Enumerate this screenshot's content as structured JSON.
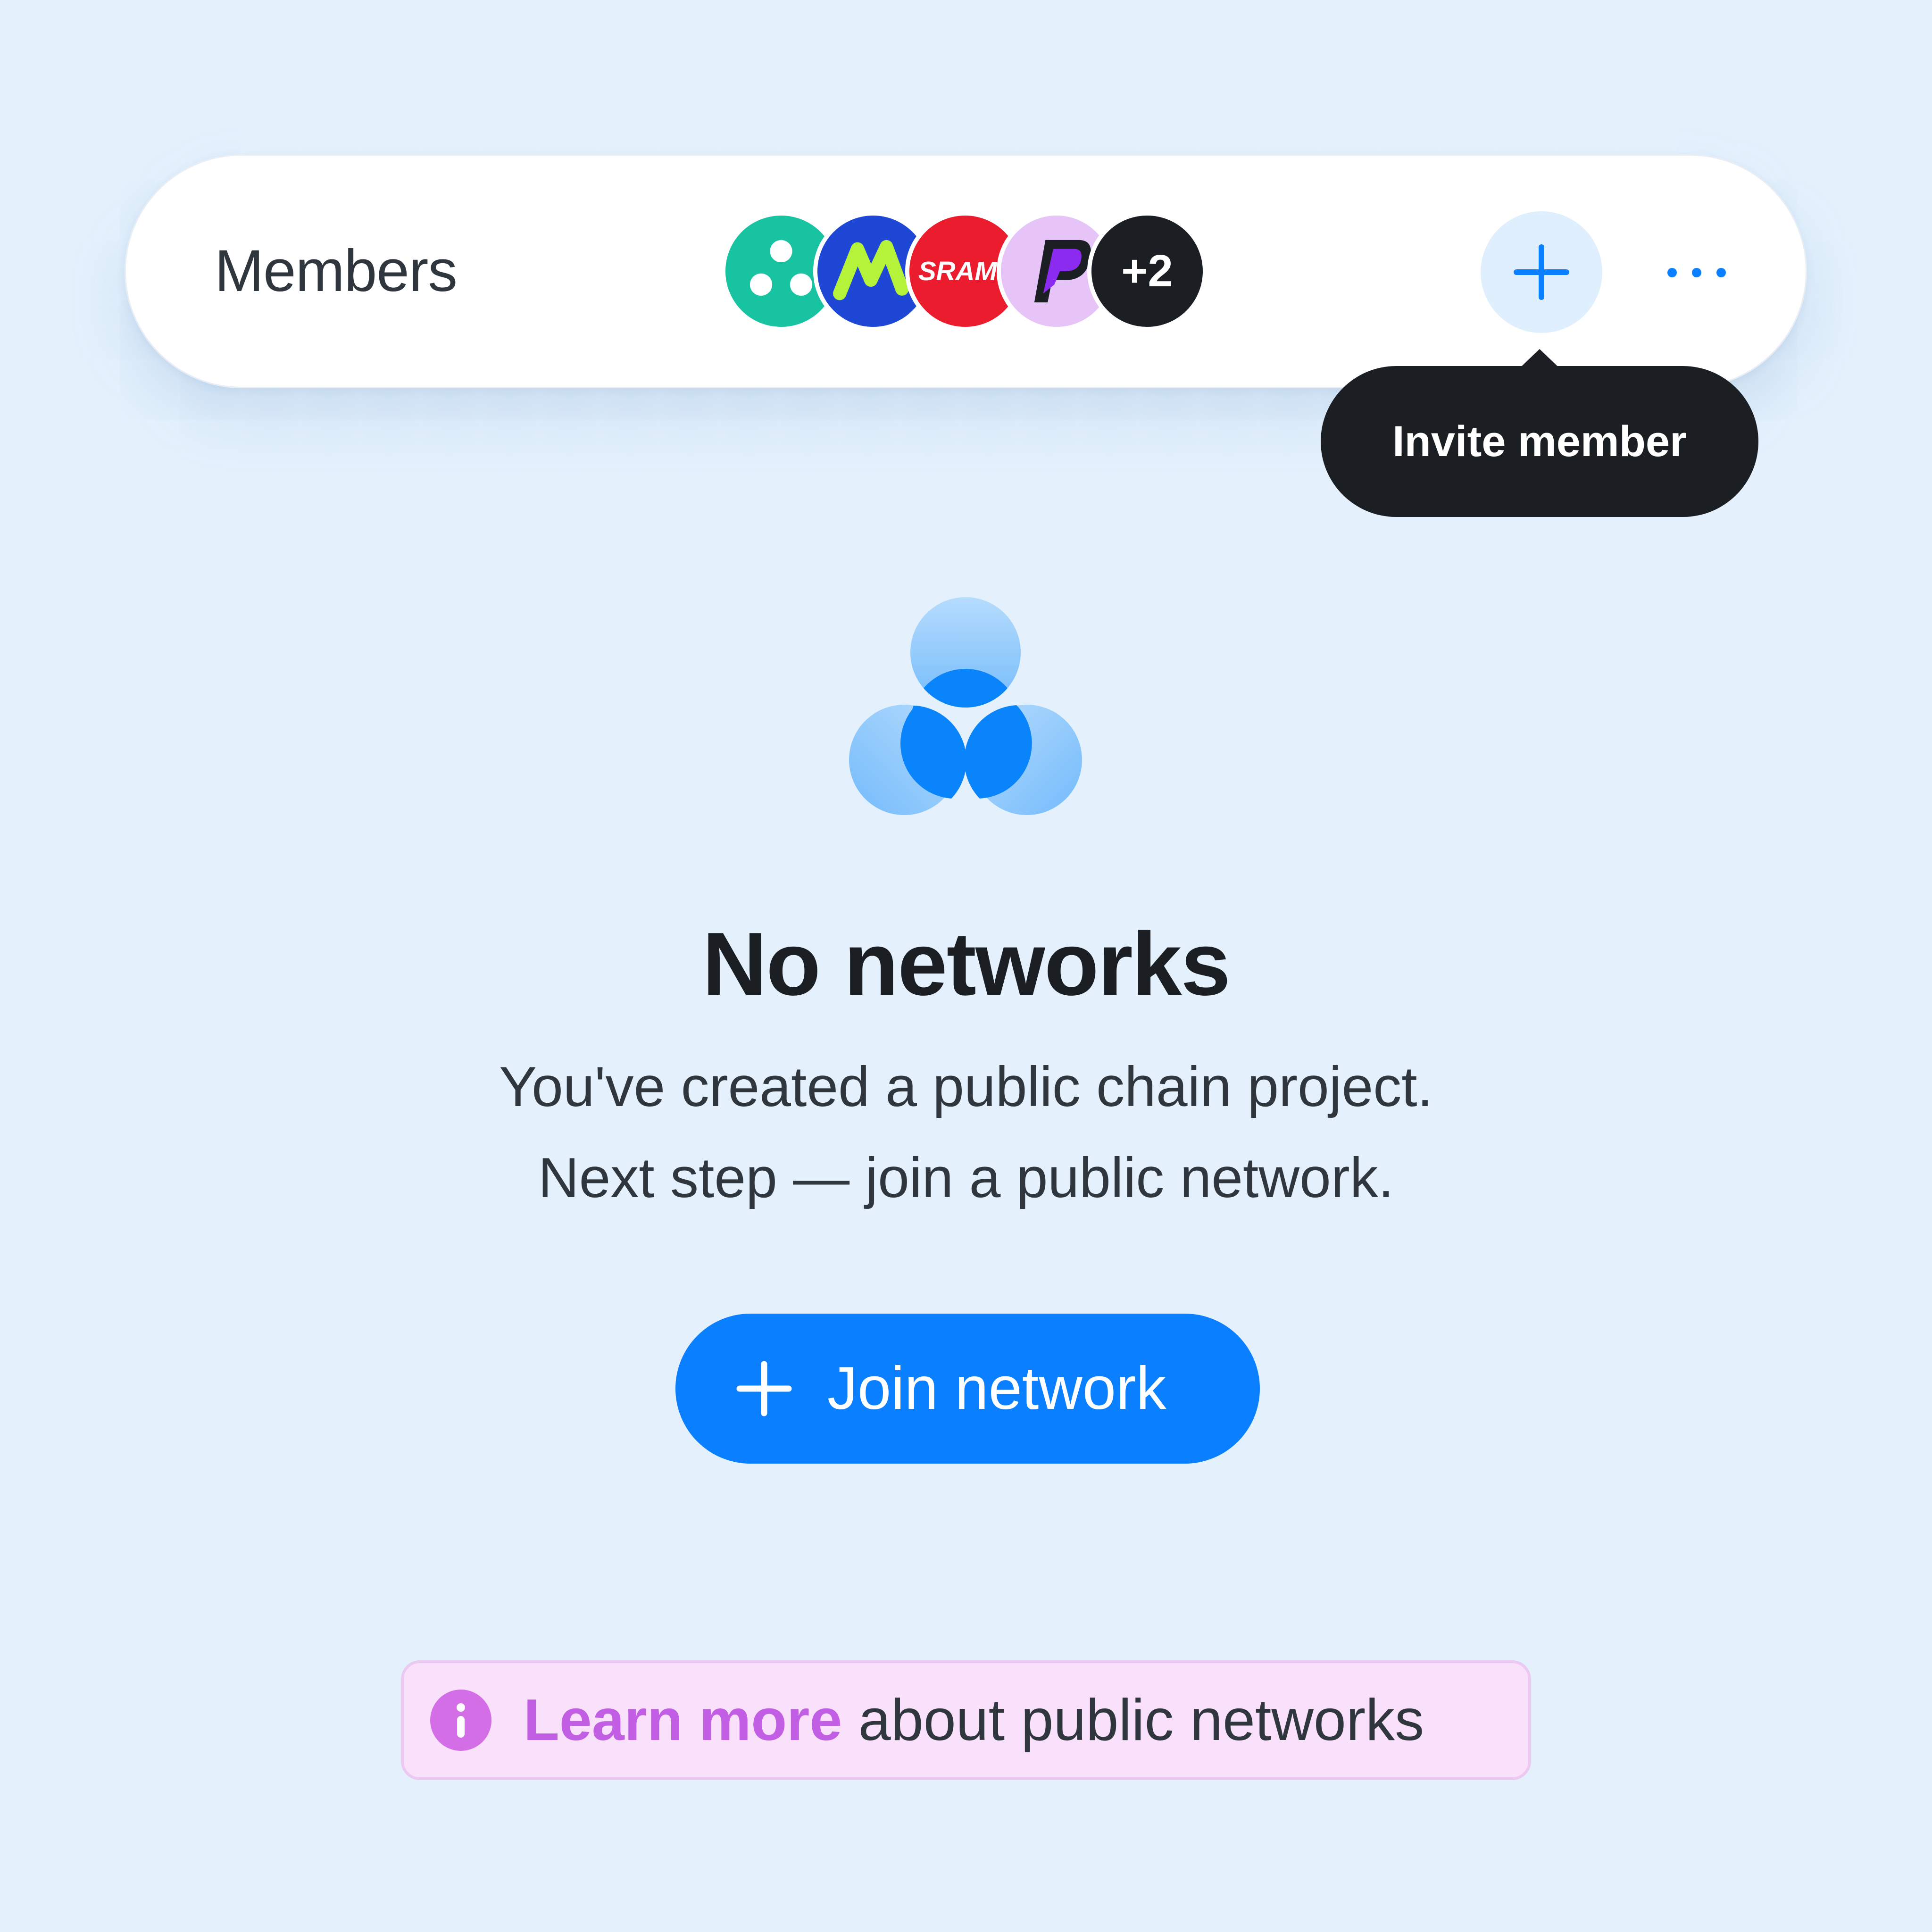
{
  "members_bar": {
    "label": "Members",
    "extra_count": "+2",
    "avatars": [
      {
        "icon": "three-dots-logo-icon",
        "color": "#17c3a0"
      },
      {
        "icon": "m-logo-icon",
        "color": "#1f47d6"
      },
      {
        "icon": "sram-logo-icon",
        "color": "#ec1c2f",
        "text": "SRAM"
      },
      {
        "icon": "p-logo-icon",
        "color": "#e6c4f8"
      }
    ],
    "invite_icon": "plus-icon",
    "more_icon": "more-horizontal-icon"
  },
  "tooltip": {
    "text": "Invite member"
  },
  "empty_state": {
    "icon": "networks-circles-icon",
    "title": "No networks",
    "line1": "You've created a public chain project.",
    "line2": "Next step — join a public network.",
    "button_label": "Join network",
    "button_icon": "plus-icon"
  },
  "info_banner": {
    "icon": "info-icon",
    "link_text": "Learn more",
    "text": " about public networks"
  },
  "colors": {
    "background": "#e4f1fd",
    "accent": "#0a7fff",
    "dark": "#1b1f24",
    "info_accent": "#c25ee3",
    "info_bg": "#f9e0fb"
  }
}
